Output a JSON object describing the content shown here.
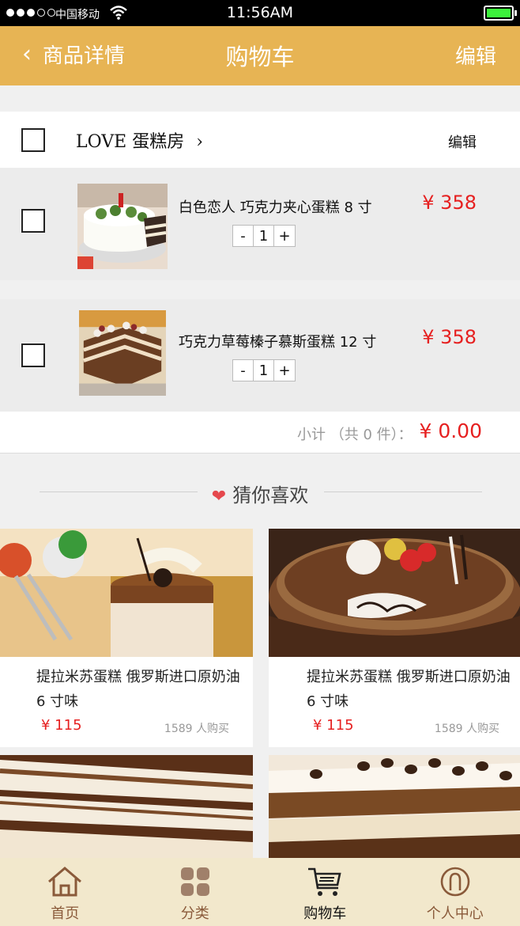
{
  "status_bar": {
    "carrier": "中国移动",
    "time": "11:56AM"
  },
  "nav": {
    "back_label": "商品详情",
    "title": "购物车",
    "edit_label": "编辑"
  },
  "shop": {
    "name": "LOVE 蛋糕房",
    "edit_label": "编辑"
  },
  "cart_items": [
    {
      "name": "白色恋人  巧克力夹心蛋糕  8 寸",
      "quantity": "1",
      "price": "¥ 358",
      "minus": "-",
      "plus": "+"
    },
    {
      "name": "巧克力草莓榛子慕斯蛋糕  12 寸",
      "quantity": "1",
      "price": "¥ 358",
      "minus": "-",
      "plus": "+"
    }
  ],
  "subtotal": {
    "label": "小计 （共 0 件）：",
    "total": "¥ 0.00"
  },
  "recommend": {
    "heading": "猜你喜欢",
    "products": [
      {
        "name": "提拉米苏蛋糕  俄罗斯进口原奶油 6 寸味",
        "price": "¥ 115",
        "sold": "1589 人购买"
      },
      {
        "name": "提拉米苏蛋糕  俄罗斯进口原奶油 6 寸味",
        "price": "¥ 115",
        "sold": "1589 人购买"
      }
    ]
  },
  "tabs": [
    {
      "label": "首页",
      "icon": "home-icon"
    },
    {
      "label": "分类",
      "icon": "category-grid-icon"
    },
    {
      "label": "购物车",
      "icon": "cart-icon",
      "active": true
    },
    {
      "label": "个人中心",
      "icon": "profile-icon"
    }
  ],
  "colors": {
    "accent": "#e7b454",
    "price_red": "#e62020",
    "tabbar_bg": "#f2e8cc",
    "tab_text": "#8a5a3a"
  }
}
